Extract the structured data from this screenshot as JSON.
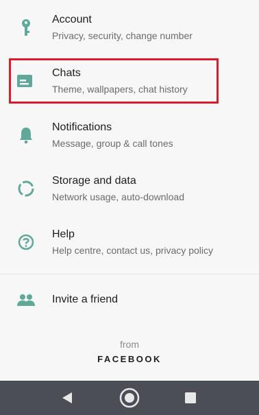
{
  "settings": {
    "items": [
      {
        "icon": "key-icon",
        "title": "Account",
        "subtitle": "Privacy, security, change number"
      },
      {
        "icon": "chat-icon",
        "title": "Chats",
        "subtitle": "Theme, wallpapers, chat history"
      },
      {
        "icon": "bell-icon",
        "title": "Notifications",
        "subtitle": "Message, group & call tones"
      },
      {
        "icon": "storage-icon",
        "title": "Storage and data",
        "subtitle": "Network usage, auto-download"
      },
      {
        "icon": "help-icon",
        "title": "Help",
        "subtitle": "Help centre, contact us, privacy policy"
      }
    ],
    "invite": {
      "icon": "people-icon",
      "title": "Invite a friend"
    }
  },
  "footer": {
    "from": "from",
    "brand": "FACEBOOK"
  },
  "navbar": {
    "buttons": [
      "back-icon",
      "home-icon",
      "recents-icon"
    ]
  },
  "colors": {
    "accent": "#5fa89a",
    "highlight": "#e0182c",
    "navbar": "#4b4f55"
  }
}
